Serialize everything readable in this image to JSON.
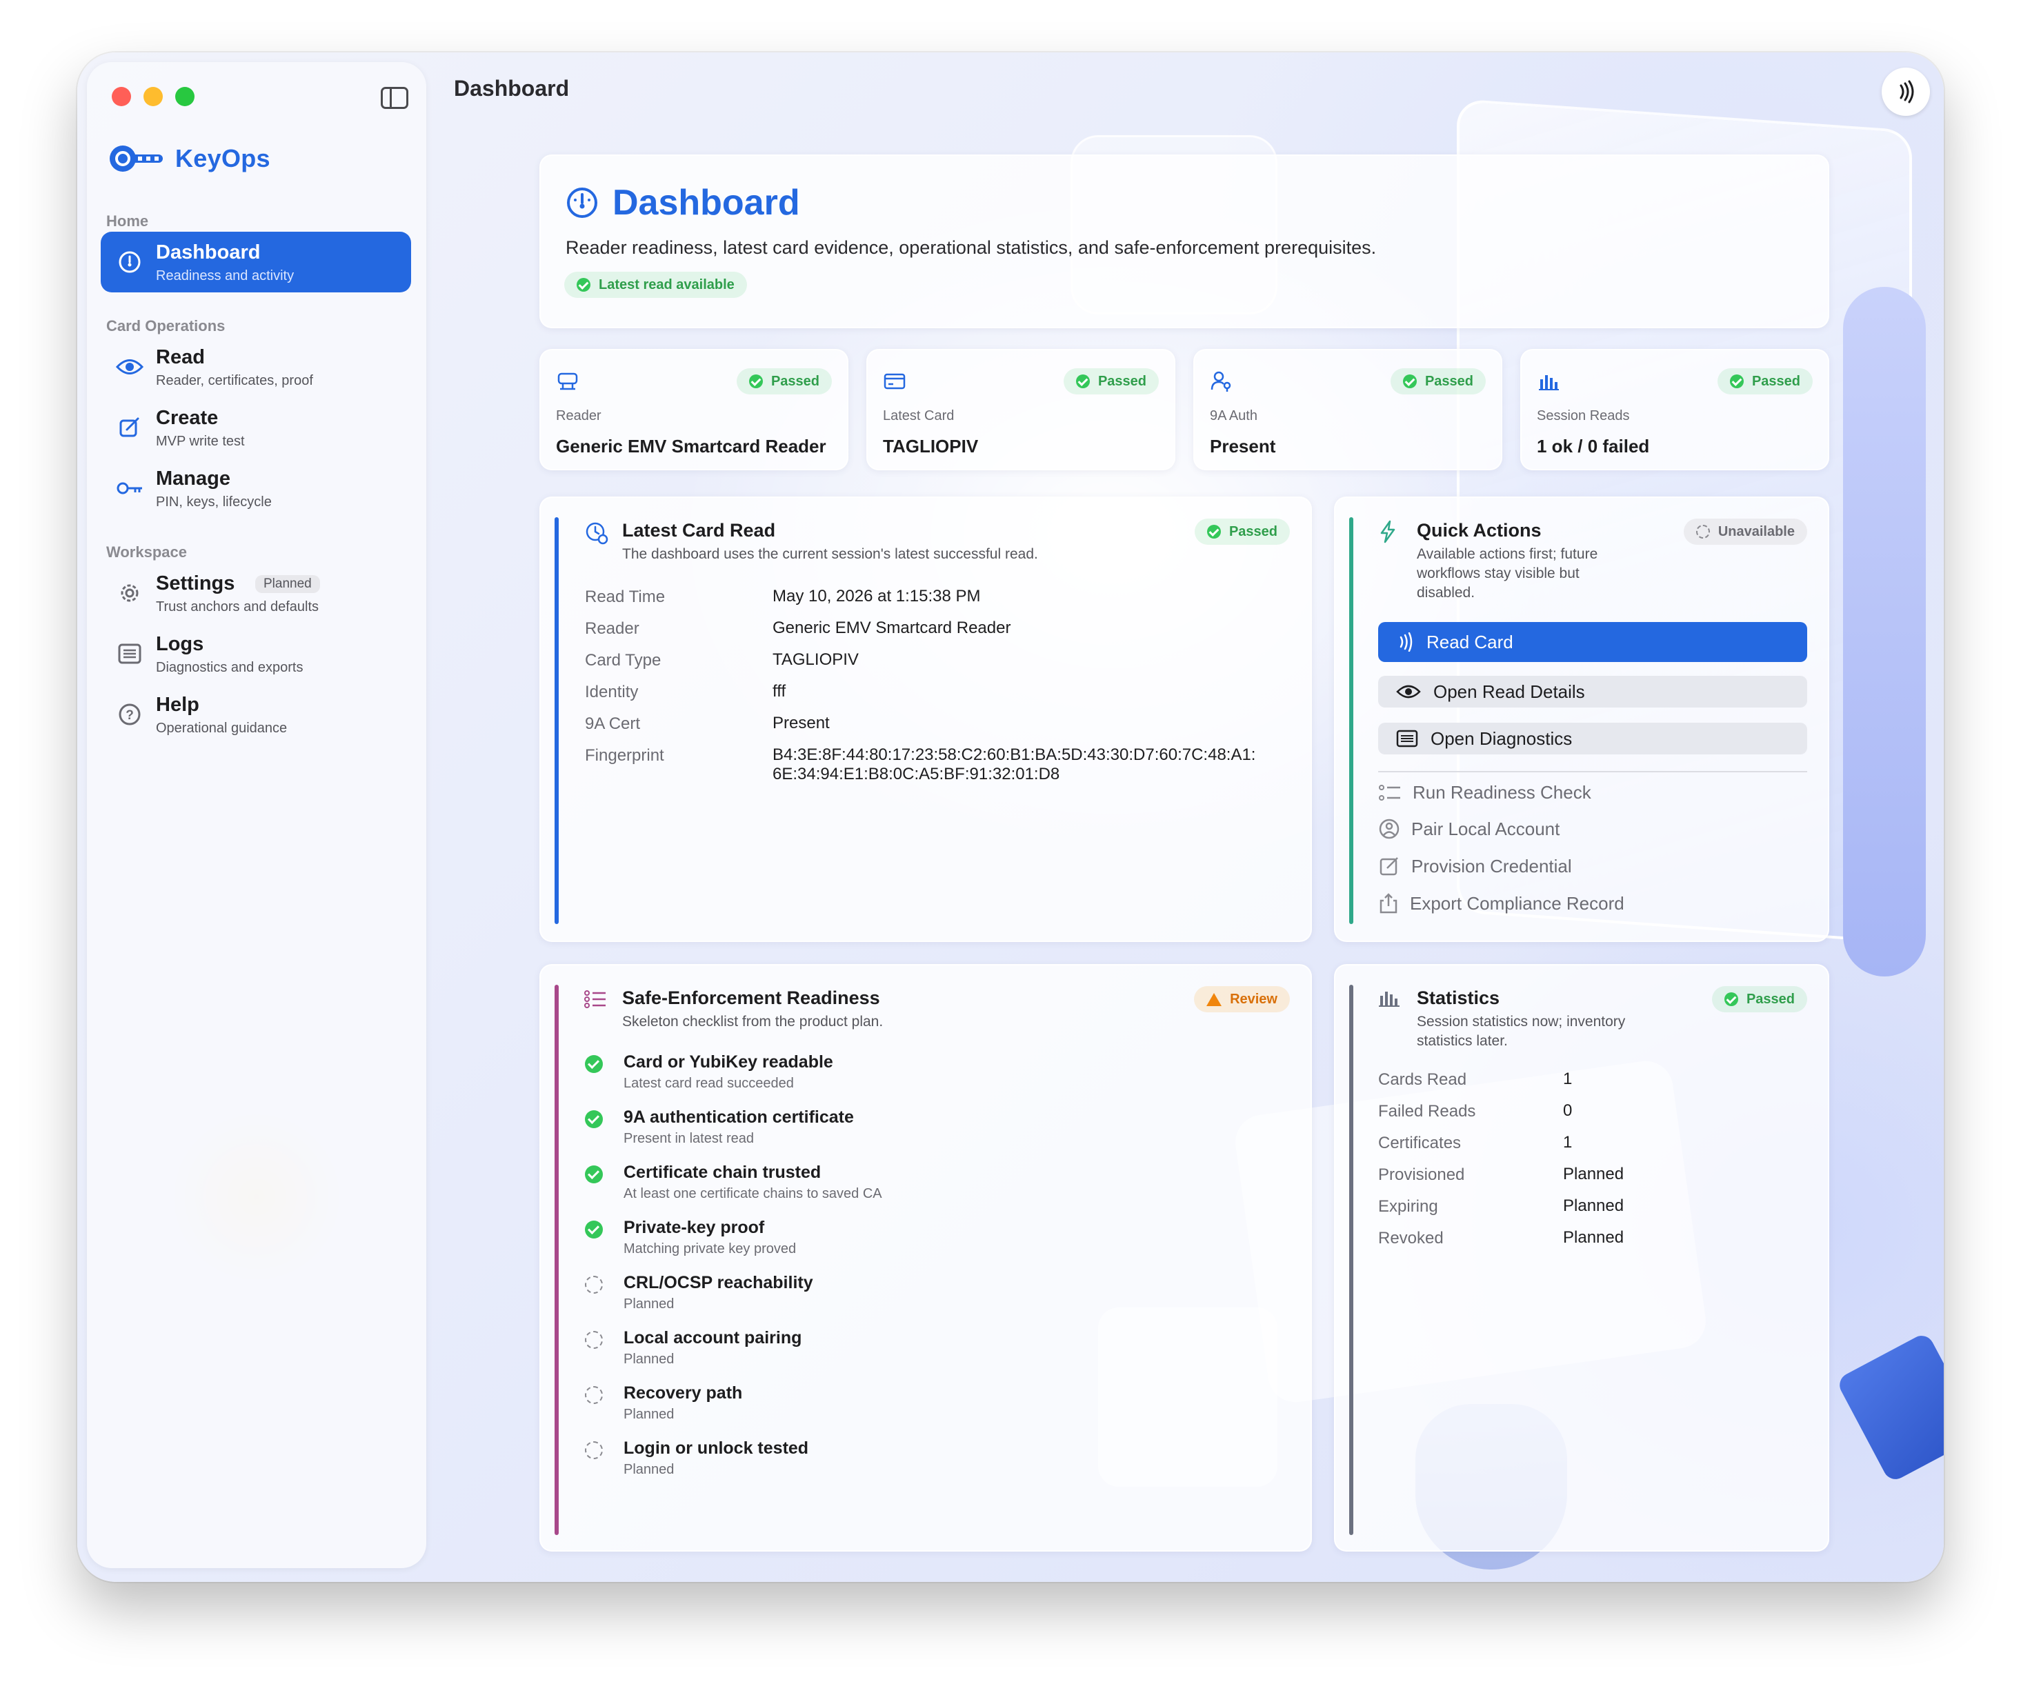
{
  "window": {
    "title": "Dashboard"
  },
  "app": {
    "name": "KeyOps",
    "accent": "#2468e0"
  },
  "sidebar": {
    "sections": [
      {
        "label": "Home"
      },
      {
        "label": "Card Operations"
      },
      {
        "label": "Workspace"
      }
    ],
    "items": [
      {
        "title": "Dashboard",
        "subtitle": "Readiness and activity",
        "icon": "gauge-icon",
        "active": true
      },
      {
        "title": "Read",
        "subtitle": "Reader, certificates, proof",
        "icon": "eye-icon"
      },
      {
        "title": "Create",
        "subtitle": "MVP write test",
        "icon": "edit-icon"
      },
      {
        "title": "Manage",
        "subtitle": "PIN, keys, lifecycle",
        "icon": "key-icon"
      },
      {
        "title": "Settings",
        "subtitle": "Trust anchors and defaults",
        "icon": "gear-icon",
        "badge": "Planned"
      },
      {
        "title": "Logs",
        "subtitle": "Diagnostics and exports",
        "icon": "list-icon"
      },
      {
        "title": "Help",
        "subtitle": "Operational guidance",
        "icon": "question-icon"
      }
    ]
  },
  "hero": {
    "title": "Dashboard",
    "description": "Reader readiness, latest card evidence, operational statistics, and safe-enforcement prerequisites.",
    "badge": "Latest read available"
  },
  "stat_cards": [
    {
      "label": "Reader",
      "value": "Generic EMV Smartcard Reader",
      "badge": "Passed",
      "icon": "reader-icon"
    },
    {
      "label": "Latest Card",
      "value": "TAGLIOPIV",
      "badge": "Passed",
      "icon": "card-icon"
    },
    {
      "label": "9A Auth",
      "value": "Present",
      "badge": "Passed",
      "icon": "person-key-icon"
    },
    {
      "label": "Session Reads",
      "value": "1 ok / 0 failed",
      "badge": "Passed",
      "icon": "bar-chart-icon"
    }
  ],
  "latest_read": {
    "title": "Latest Card Read",
    "subtitle": "The dashboard uses the current session's latest successful read.",
    "badge": "Passed",
    "rows": [
      {
        "key": "Read Time",
        "value": "May 10, 2026 at 1:15:38 PM"
      },
      {
        "key": "Reader",
        "value": "Generic EMV Smartcard Reader"
      },
      {
        "key": "Card Type",
        "value": "TAGLIOPIV"
      },
      {
        "key": "Identity",
        "value": "fff"
      },
      {
        "key": "9A Cert",
        "value": "Present"
      },
      {
        "key": "Fingerprint",
        "value": "B4:3E:8F:44:80:17:23:58:C2:60:B1:BA:5D:43:30:D7:60:7C:48:A1:",
        "value2": "6E:34:94:E1:B8:0C:A5:BF:91:32:01:D8"
      }
    ]
  },
  "quick_actions": {
    "title": "Quick Actions",
    "subtitle1": "Available actions first; future",
    "subtitle2": "workflows stay visible but",
    "subtitle3": "disabled.",
    "badge": "Unavailable",
    "primary": "Read Card",
    "secondary": [
      "Open Read Details",
      "Open Diagnostics"
    ],
    "disabled": [
      "Run Readiness Check",
      "Pair Local Account",
      "Provision Credential",
      "Export Compliance Record"
    ]
  },
  "readiness": {
    "title": "Safe-Enforcement Readiness",
    "subtitle": "Skeleton checklist from the product plan.",
    "badge": "Review",
    "items": [
      {
        "title": "Card or YubiKey readable",
        "detail": "Latest card read succeeded",
        "done": true
      },
      {
        "title": "9A authentication certificate",
        "detail": "Present in latest read",
        "done": true
      },
      {
        "title": "Certificate chain trusted",
        "detail": "At least one certificate chains to saved CA",
        "done": true
      },
      {
        "title": "Private-key proof",
        "detail": "Matching private key proved",
        "done": true
      },
      {
        "title": "CRL/OCSP reachability",
        "detail": "Planned",
        "done": false
      },
      {
        "title": "Local account pairing",
        "detail": "Planned",
        "done": false
      },
      {
        "title": "Recovery path",
        "detail": "Planned",
        "done": false
      },
      {
        "title": "Login or unlock tested",
        "detail": "Planned",
        "done": false
      }
    ]
  },
  "statistics": {
    "title": "Statistics",
    "subtitle1": "Session statistics now; inventory",
    "subtitle2": "statistics later.",
    "badge": "Passed",
    "rows": [
      {
        "key": "Cards Read",
        "value": "1"
      },
      {
        "key": "Failed Reads",
        "value": "0"
      },
      {
        "key": "Certificates",
        "value": "1"
      },
      {
        "key": "Provisioned",
        "value": "Planned"
      },
      {
        "key": "Expiring",
        "value": "Planned"
      },
      {
        "key": "Revoked",
        "value": "Planned"
      }
    ]
  },
  "colors": {
    "passed": "#34c759",
    "review": "#f0850c",
    "latest_accent": "#2468e0",
    "quick_accent": "#2fa88a",
    "readiness_accent": "#a8488a",
    "stats_accent": "#6b7080"
  }
}
